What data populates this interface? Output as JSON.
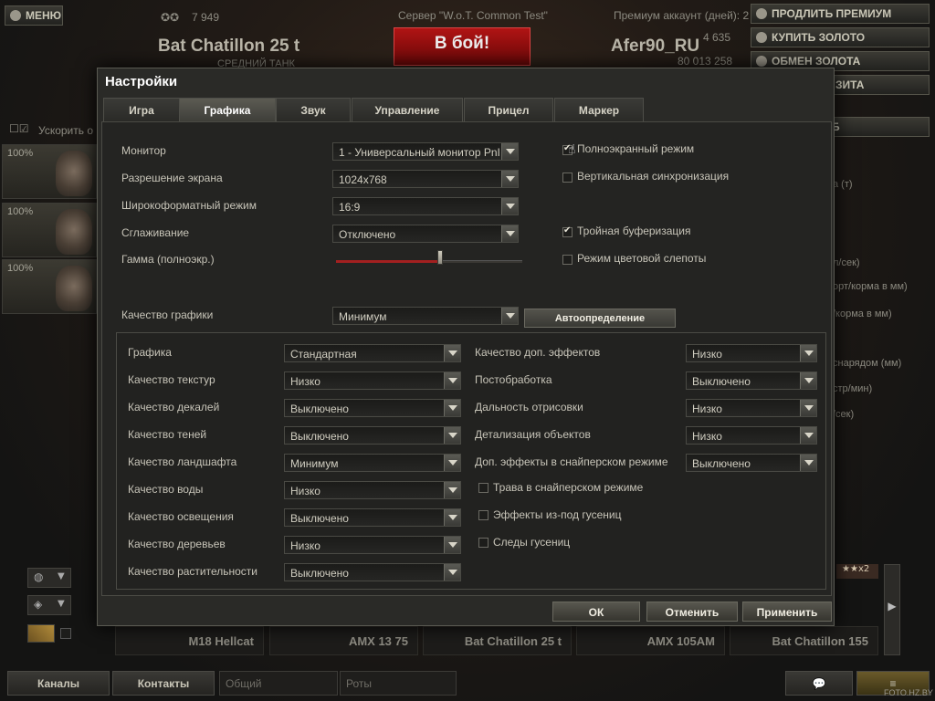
{
  "hangar": {
    "menu_label": "МЕНЮ",
    "server": "Сервер \"W.o.T. Common Test\"",
    "premium_days": "Премиум аккаунт (дней): 2",
    "tank_name": "Bat Chatillon 25 t",
    "tank_class": "СРЕДНИЙ ТАНК",
    "tank_count": "7 949",
    "battle_label": "В бой!",
    "username": "Afer90_RU",
    "gold": "4 635",
    "credits": "80 013 258",
    "right_buttons": [
      "ПРОДЛИТЬ ПРЕМИУМ",
      "КУПИТЬ ЗОЛОТО",
      "ОБМЕН ЗОЛОТА",
      "ЗИТА"
    ],
    "accelerate_label": "Ускорить о",
    "crew_percent": [
      "100%",
      "100%",
      "100%"
    ],
    "right_partial": [
      "а (т)",
      "л/сек)",
      "орт/корма в мм)",
      "/корма в мм)",
      "снарядом (мм)",
      "стр/мин)",
      "/сек)",
      "Б"
    ],
    "carousel": [
      "M18 Hellcat",
      "AMX 13 75",
      "Bat Chatillon 25 t",
      "AMX 105AM",
      "Bat Chatillon 155"
    ],
    "carousel_badge": "x2",
    "bottom_buttons": {
      "channels": "Каналы",
      "contacts": "Контакты"
    },
    "bottom_inputs": {
      "common": "Общий",
      "companies": "Роты"
    },
    "watermark": "FOTO.HZ.BY"
  },
  "dialog": {
    "title": "Настройки",
    "tabs": [
      "Игра",
      "Графика",
      "Звук",
      "Управление",
      "Прицел",
      "Маркер"
    ],
    "active_tab": "Графика",
    "monitor_label": "Монитор",
    "monitor_value": "1 - Универсальный монитор PnI",
    "resolution_label": "Разрешение экрана",
    "resolution_value": "1024x768",
    "widescreen_label": "Широкоформатный режим",
    "widescreen_value": "16:9",
    "aa_label": "Сглаживание",
    "aa_value": "Отключено",
    "gamma_label": "Гамма (полноэкр.)",
    "gamma_level": 0.56,
    "fullscreen_label": "Полноэкранный режим",
    "fullscreen_checked": true,
    "vsync_label": "Вертикальная синхронизация",
    "vsync_checked": false,
    "triple_label": "Тройная буферизация",
    "triple_checked": true,
    "colorblind_label": "Режим цветовой слепоты",
    "colorblind_checked": false,
    "quality_label": "Качество графики",
    "quality_value": "Минимум",
    "auto_label": "Автоопределение",
    "left_settings": [
      {
        "label": "Графика",
        "value": "Стандартная"
      },
      {
        "label": "Качество текстур",
        "value": "Низко"
      },
      {
        "label": "Качество декалей",
        "value": "Выключено"
      },
      {
        "label": "Качество теней",
        "value": "Выключено"
      },
      {
        "label": "Качество ландшафта",
        "value": "Минимум"
      },
      {
        "label": "Качество воды",
        "value": "Низко"
      },
      {
        "label": "Качество освещения",
        "value": "Выключено"
      },
      {
        "label": "Качество деревьев",
        "value": "Низко"
      },
      {
        "label": "Качество растительности",
        "value": "Выключено"
      }
    ],
    "right_settings": [
      {
        "label": "Качество доп. эффектов",
        "value": "Низко"
      },
      {
        "label": "Постобработка",
        "value": "Выключено"
      },
      {
        "label": "Дальность отрисовки",
        "value": "Низко"
      },
      {
        "label": "Детализация объектов",
        "value": "Низко"
      },
      {
        "label": "Доп. эффекты в снайперском режиме",
        "value": "Выключено"
      }
    ],
    "right_checks": [
      {
        "label": "Трава в снайперском режиме",
        "checked": false
      },
      {
        "label": "Эффекты из-под гусениц",
        "checked": false
      },
      {
        "label": "Следы гусениц",
        "checked": false
      }
    ],
    "ok_label": "ОК",
    "cancel_label": "Отменить",
    "apply_label": "Применить"
  }
}
